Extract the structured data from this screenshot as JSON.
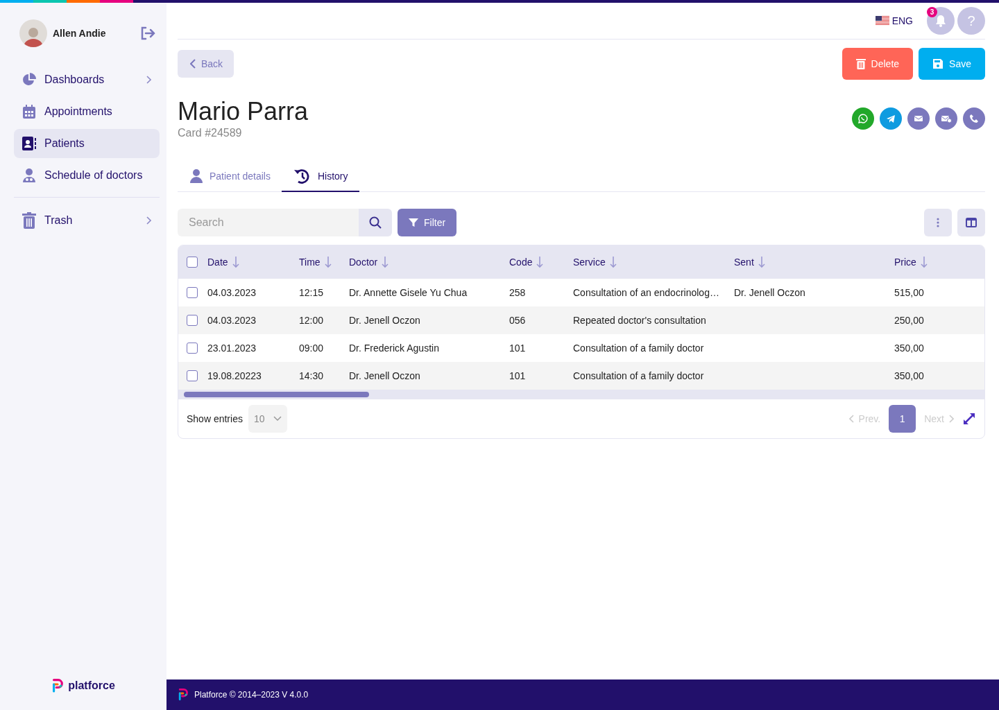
{
  "user": {
    "name": "Allen Andie"
  },
  "nav": [
    {
      "label": "Dashboards",
      "selected": false,
      "expandable": true
    },
    {
      "label": "Appointments",
      "selected": false,
      "expandable": false
    },
    {
      "label": "Patients",
      "selected": true,
      "expandable": false
    },
    {
      "label": "Schedule of doctors",
      "selected": false,
      "expandable": false
    },
    {
      "label": "Trash",
      "selected": false,
      "expandable": true,
      "divider_before": true
    }
  ],
  "brand": "platforce",
  "language": "ENG",
  "notifications": {
    "count": "3"
  },
  "help": "?",
  "back_button": "Back",
  "delete_button": "Delete",
  "save_button": "Save",
  "patient": {
    "name": "Mario Parra",
    "card": "Card #24589"
  },
  "contacts": [
    {
      "kind": "whatsapp",
      "color": "#22a82a"
    },
    {
      "kind": "telegram",
      "color": "#0f9be0"
    },
    {
      "kind": "email",
      "color": "#7b78bd"
    },
    {
      "kind": "email-check",
      "color": "#7b78bd"
    },
    {
      "kind": "phone",
      "color": "#7b78bd"
    }
  ],
  "tabs": [
    {
      "label": "Patient details",
      "selected": false
    },
    {
      "label": "History",
      "selected": true
    }
  ],
  "search": {
    "placeholder": "Search"
  },
  "filter_button": "Filter",
  "table": {
    "header_checked": false,
    "columns": [
      "Date",
      "Time",
      "Doctor",
      "Code",
      "Service",
      "Sent",
      "Price"
    ],
    "rows": [
      {
        "checked": false,
        "cells": [
          "04.03.2023",
          "12:15",
          "Dr. Annette Gisele Yu Chua",
          "258",
          "Consultation of an endocrinolog…",
          "Dr. Jenell Oczon",
          "515,00"
        ]
      },
      {
        "checked": false,
        "cells": [
          "04.03.2023",
          "12:00",
          "Dr. Jenell Oczon",
          "056",
          "Repeated doctor's consultation",
          "",
          "250,00"
        ]
      },
      {
        "checked": false,
        "cells": [
          "23.01.2023",
          "09:00",
          "Dr. Frederick Agustin",
          "101",
          "Consultation of a family doctor",
          "",
          "350,00"
        ]
      },
      {
        "checked": false,
        "cells": [
          "19.08.20223",
          "14:30",
          "Dr. Jenell Oczon",
          "101",
          "Consultation of a family doctor",
          "",
          "350,00"
        ]
      }
    ]
  },
  "pagination": {
    "show_entries": "Show entries",
    "page_size": "10",
    "prev": "Prev.",
    "next": "Next",
    "pages": [
      {
        "label": "1",
        "selected": true
      }
    ]
  },
  "footer": "Platforce © 2014–2023 V 4.0.0"
}
